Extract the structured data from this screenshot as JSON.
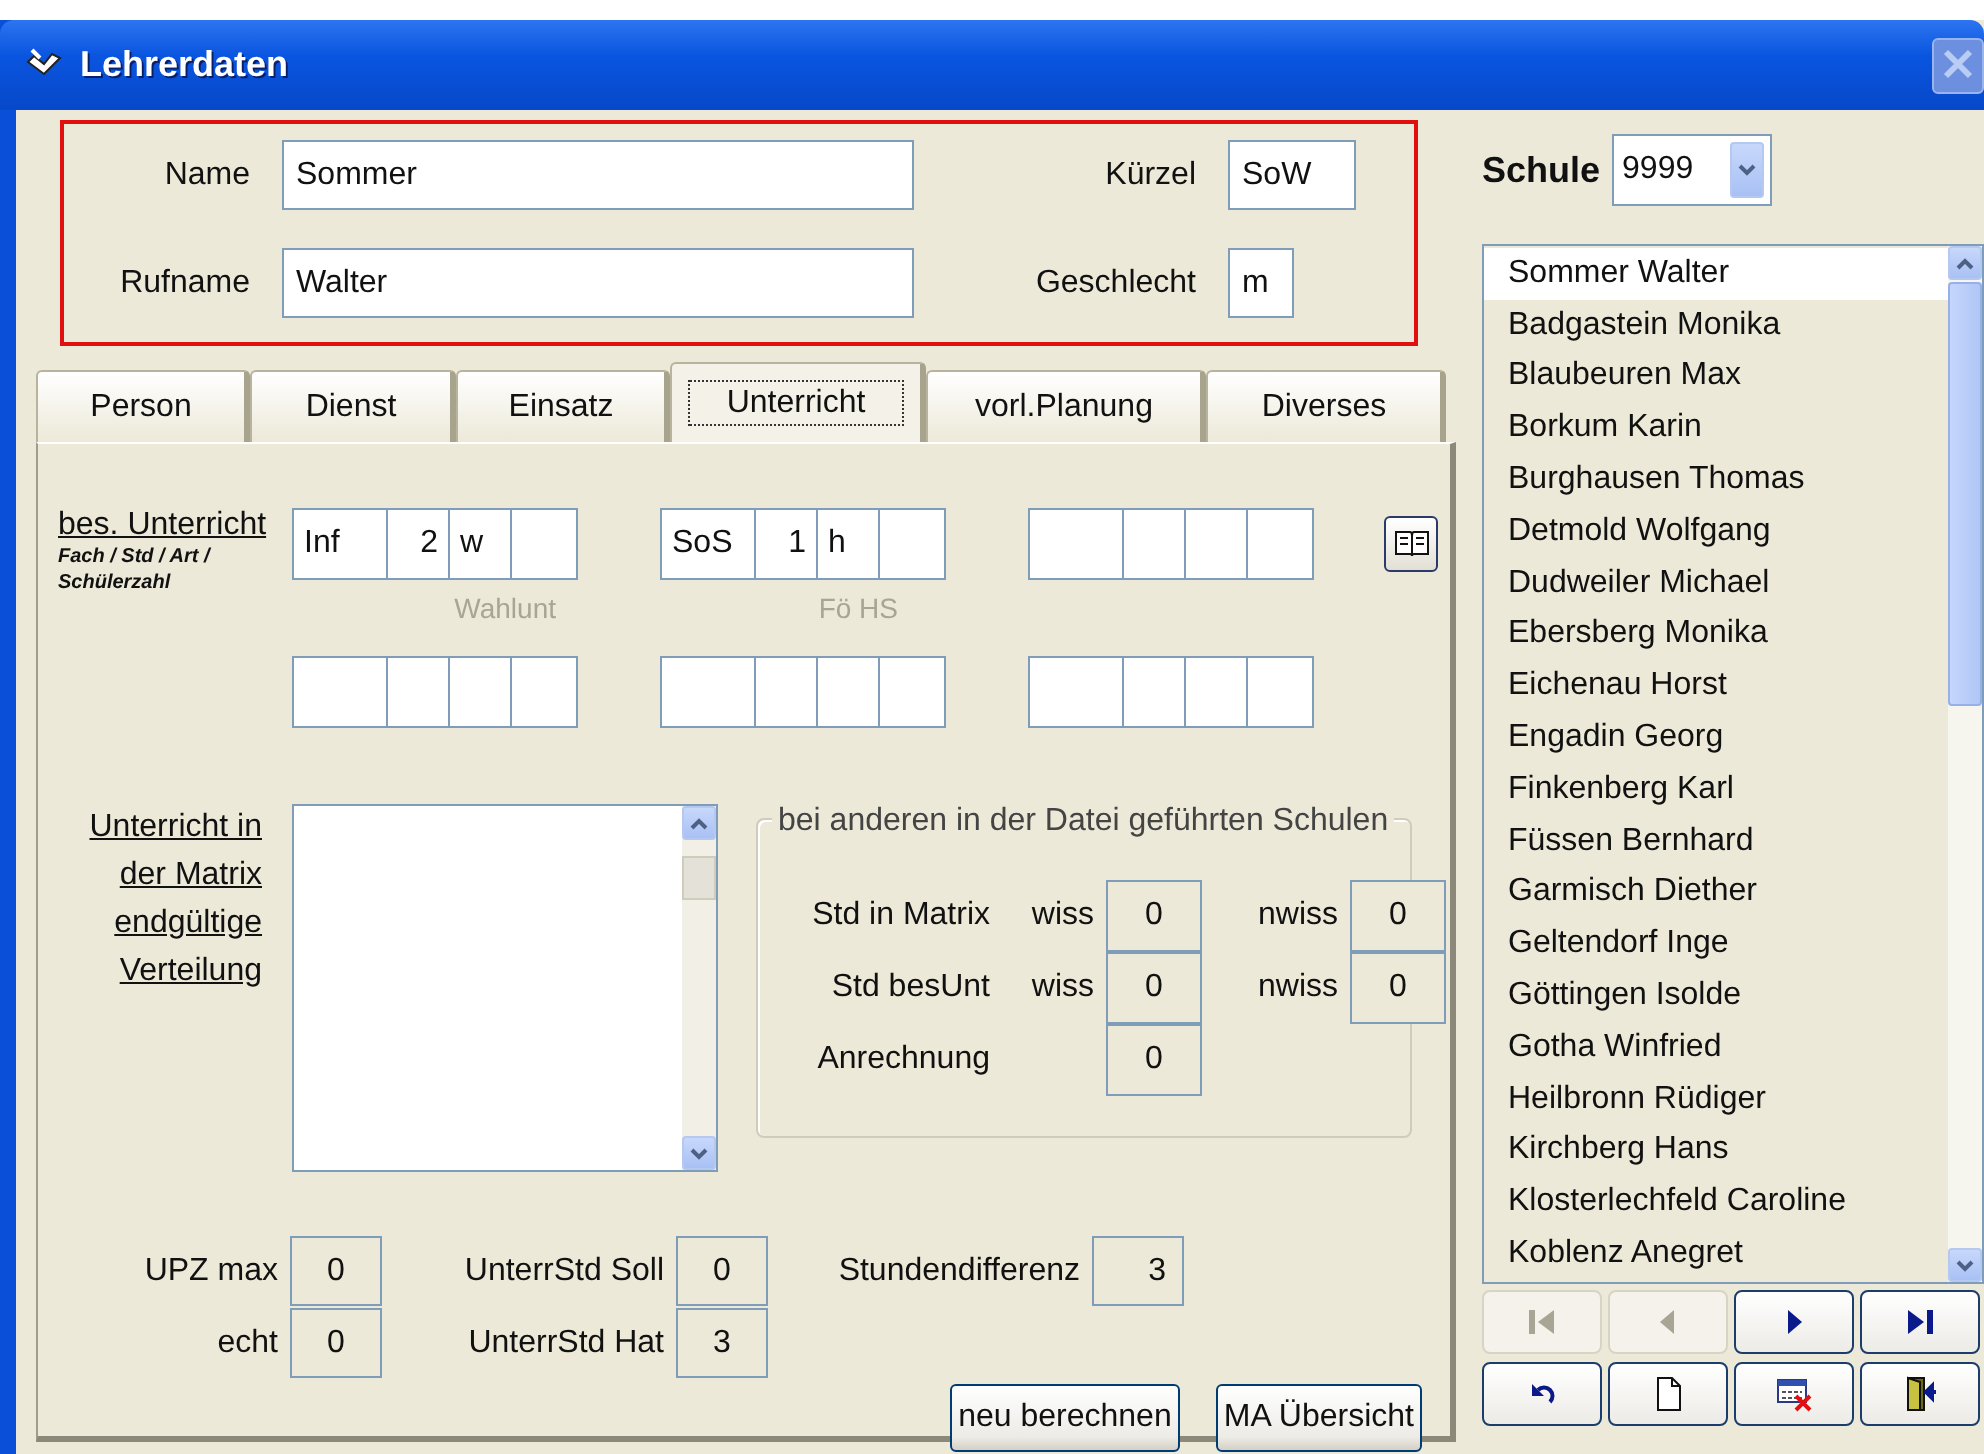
{
  "window": {
    "title": "Lehrerdaten"
  },
  "person_fields": [
    {
      "label": "Name",
      "value": "Sommer"
    },
    {
      "label": "Kürzel",
      "value": "SoW"
    },
    {
      "label": "Rufname",
      "value": "Walter"
    },
    {
      "label": "Geschlecht",
      "value": "m"
    }
  ],
  "tabs": [
    {
      "label": "Person",
      "selected": false
    },
    {
      "label": "Dienst",
      "selected": false
    },
    {
      "label": "Einsatz",
      "selected": false
    },
    {
      "label": "Unterricht",
      "selected": true
    },
    {
      "label": "vorl.Planung",
      "selected": false
    },
    {
      "label": "Diverses",
      "selected": false
    }
  ],
  "bes_unterricht": {
    "label": "bes. Unterricht",
    "hint": "Fach / Std / Art / Schülerzahl",
    "rows": [
      [
        {
          "cells": [
            {
              "value": "Inf"
            },
            {
              "value": "2"
            },
            {
              "value": "w"
            },
            {}
          ],
          "caption": "Wahlunt"
        },
        {
          "cells": [
            {
              "value": "SoS"
            },
            {
              "value": "1"
            },
            {
              "value": "h"
            },
            {}
          ],
          "caption": "Fö HS"
        },
        {
          "cells": [
            {},
            {},
            {},
            {}
          ]
        }
      ],
      [
        {
          "cells": [
            {},
            {},
            {},
            {}
          ]
        },
        {
          "cells": [
            {},
            {},
            {},
            {}
          ]
        },
        {
          "cells": [
            {},
            {},
            {},
            {}
          ]
        }
      ]
    ]
  },
  "matrix": {
    "label": "Unterricht in der Matrix endgültige Verteilung"
  },
  "other_schools": {
    "title": "bei anderen in der Datei geführten Schulen",
    "rows": [
      {
        "label": "Std in Matrix",
        "values": [
          {
            "label": "wiss",
            "value": "0"
          },
          {
            "label": "nwiss",
            "value": "0"
          }
        ]
      },
      {
        "label": "Std besUnt",
        "values": [
          {
            "label": "wiss",
            "value": "0"
          },
          {
            "label": "nwiss",
            "value": "0"
          }
        ]
      },
      {
        "label": "Anrechnung",
        "values": [
          {
            "value": "0"
          }
        ]
      }
    ]
  },
  "totals": [
    {
      "label": "UPZ max",
      "value": "0"
    },
    {
      "label": "UnterrStd Soll",
      "value": "0"
    },
    {
      "label": "Stundendifferenz",
      "value": "3"
    },
    {
      "label": "echt",
      "value": "0"
    },
    {
      "label": "UnterrStd Hat",
      "value": "3"
    }
  ],
  "buttons": [
    "neu berechnen",
    "MA Übersicht"
  ],
  "schule": {
    "label": "Schule",
    "value": "9999"
  },
  "teachers": [
    {
      "name": "Sommer Walter",
      "selected": true
    },
    {
      "name": "Badgastein Monika",
      "selected": false
    },
    {
      "name": "Blaubeuren Max",
      "selected": false
    },
    {
      "name": "Borkum Karin",
      "selected": false
    },
    {
      "name": "Burghausen Thomas",
      "selected": false
    },
    {
      "name": "Detmold Wolfgang",
      "selected": false
    },
    {
      "name": "Dudweiler Michael",
      "selected": false
    },
    {
      "name": "Ebersberg Monika",
      "selected": false
    },
    {
      "name": "Eichenau Horst",
      "selected": false
    },
    {
      "name": "Engadin Georg",
      "selected": false
    },
    {
      "name": "Finkenberg Karl",
      "selected": false
    },
    {
      "name": "Füssen Bernhard",
      "selected": false
    },
    {
      "name": "Garmisch Diether",
      "selected": false
    },
    {
      "name": "Geltendorf Inge",
      "selected": false
    },
    {
      "name": "Göttingen Isolde",
      "selected": false
    },
    {
      "name": "Gotha Winfried",
      "selected": false
    },
    {
      "name": "Heilbronn Rüdiger",
      "selected": false
    },
    {
      "name": "Kirchberg Hans",
      "selected": false
    },
    {
      "name": "Klosterlechfeld Caroline",
      "selected": false
    },
    {
      "name": "Koblenz Anegret",
      "selected": false
    }
  ],
  "nav_buttons": [
    {
      "kind": "first",
      "disabled": true
    },
    {
      "kind": "previous",
      "disabled": true
    },
    {
      "kind": "next",
      "disabled": false
    },
    {
      "kind": "last",
      "disabled": false
    },
    {
      "kind": "undo",
      "disabled": false
    },
    {
      "kind": "new",
      "disabled": false
    },
    {
      "kind": "delete",
      "disabled": false
    },
    {
      "kind": "exit",
      "disabled": false
    }
  ]
}
